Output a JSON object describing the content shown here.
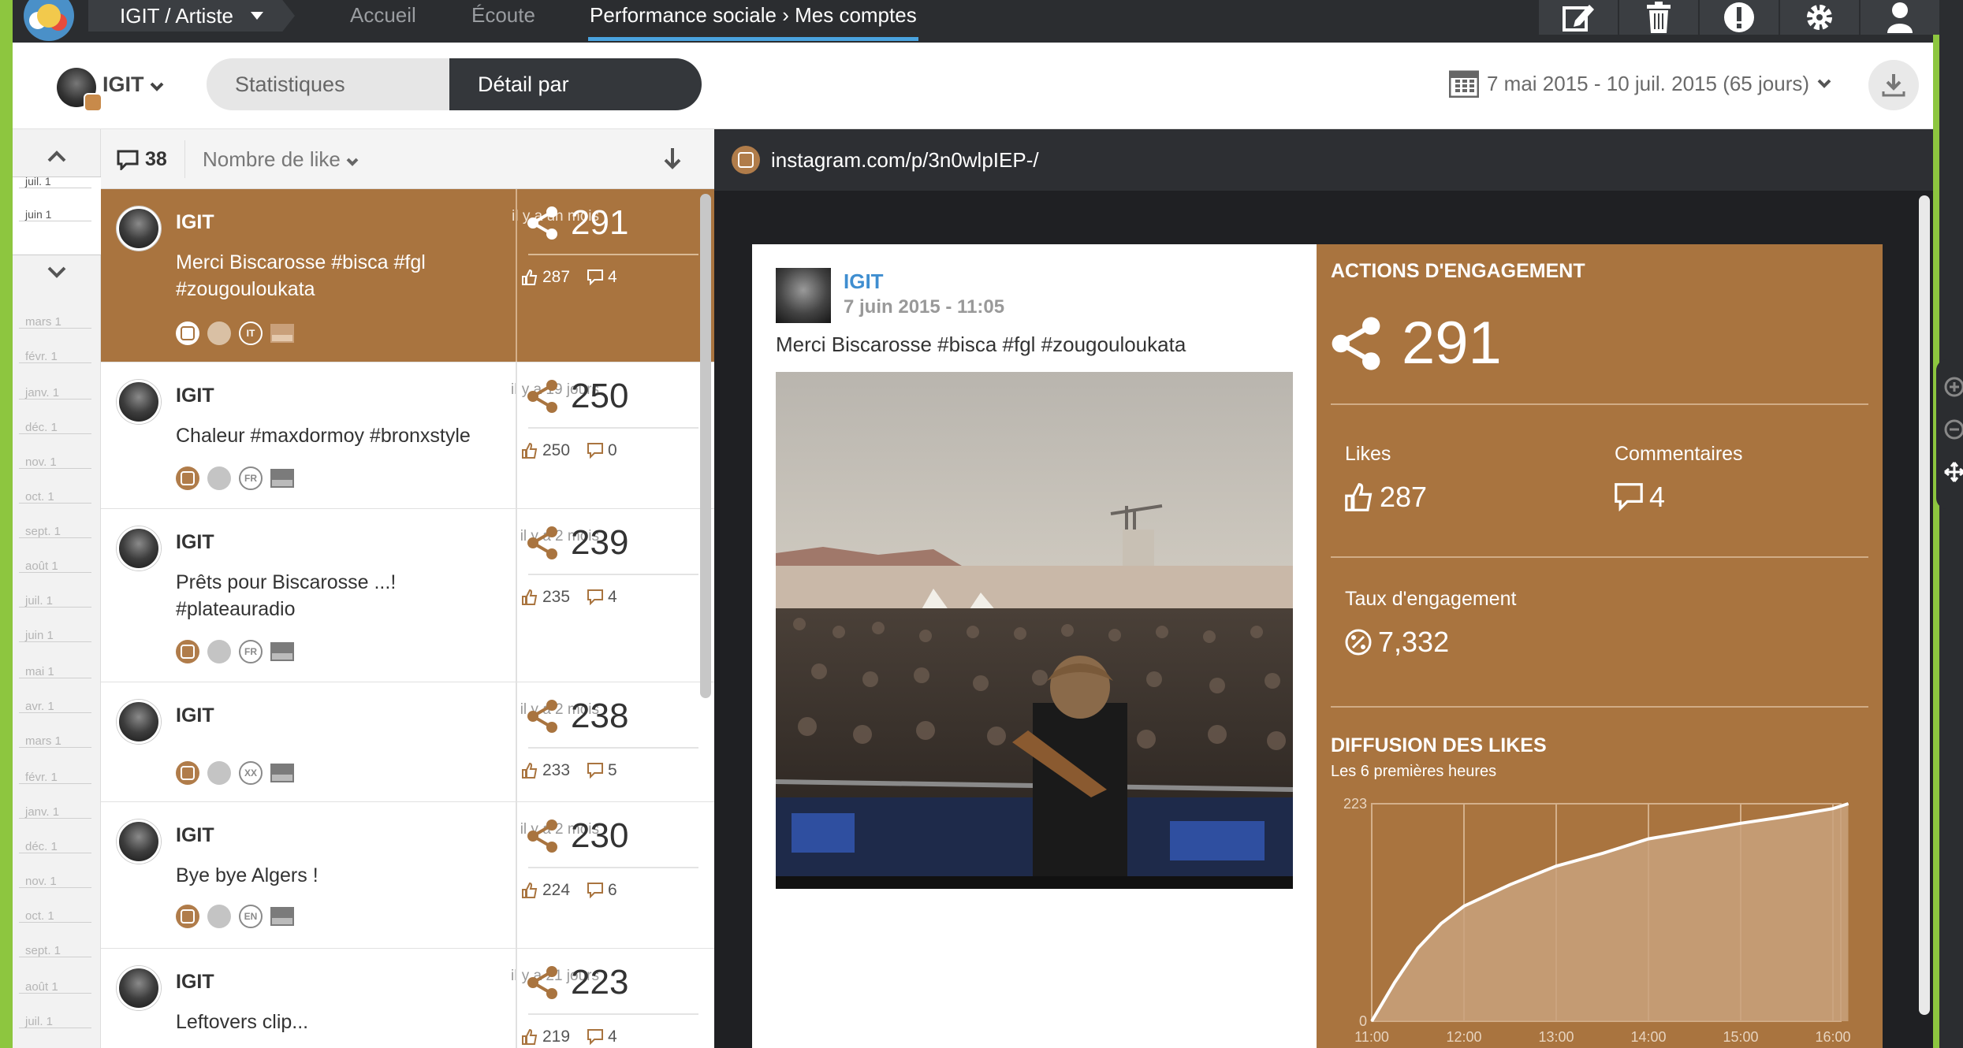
{
  "topnav": {
    "account": "IGIT / Artiste",
    "links": [
      "Accueil",
      "Écoute",
      "Performance sociale › Mes comptes"
    ],
    "icons": [
      "edit-icon",
      "trash-icon",
      "alert-icon",
      "gear-icon",
      "user-icon"
    ]
  },
  "header": {
    "account_name": "IGIT",
    "tabs": [
      "Statistiques globales",
      "Détail par publication"
    ],
    "date_range": "7 mai 2015 - 10 juil. 2015 (65 jours)"
  },
  "timeline": {
    "labels": [
      "juil. 1",
      "juin 1",
      "mai 1",
      "avr. 1",
      "mars 1",
      "févr. 1",
      "janv. 1",
      "déc. 1",
      "nov. 1",
      "oct. 1",
      "sept. 1",
      "août 1",
      "juil. 1",
      "juin 1",
      "mai 1",
      "avr. 1",
      "mars 1",
      "févr. 1",
      "janv. 1",
      "déc. 1",
      "nov. 1",
      "oct. 1",
      "sept. 1",
      "août 1",
      "juil. 1"
    ]
  },
  "list": {
    "count": "38",
    "sort_label": "Nombre de like",
    "posts": [
      {
        "author": "IGIT",
        "time": "il y a un mois",
        "text": "Merci Biscarosse #bisca #fgl #zougouloukata",
        "lang": "IT",
        "shares": "291",
        "likes": "287",
        "comments": "4"
      },
      {
        "author": "IGIT",
        "time": "il y a 19 jours",
        "text": "Chaleur #maxdormoy #bronxstyle",
        "lang": "FR",
        "shares": "250",
        "likes": "250",
        "comments": "0"
      },
      {
        "author": "IGIT",
        "time": "il y a 2 mois",
        "text": "Prêts pour Biscarosse ...! #plateauradio",
        "lang": "FR",
        "shares": "239",
        "likes": "235",
        "comments": "4"
      },
      {
        "author": "IGIT",
        "time": "il y a 2 mois",
        "text": "",
        "lang": "XX",
        "shares": "238",
        "likes": "233",
        "comments": "5"
      },
      {
        "author": "IGIT",
        "time": "il y a 2 mois",
        "text": "Bye bye Algers !",
        "lang": "EN",
        "shares": "230",
        "likes": "224",
        "comments": "6"
      },
      {
        "author": "IGIT",
        "time": "il y a 21 jours",
        "text": "Leftovers clip...",
        "lang": "",
        "shares": "223",
        "likes": "219",
        "comments": "4"
      }
    ]
  },
  "detail": {
    "url": "instagram.com/p/3n0wlpIEP-/",
    "author": "IGIT",
    "date": "7 juin 2015 - 11:05",
    "text": "Merci Biscarosse #bisca #fgl #zougouloukata",
    "engagement_heading": "ACTIONS D'ENGAGEMENT",
    "total": "291",
    "likes_label": "Likes",
    "likes": "287",
    "comments_label": "Commentaires",
    "comments": "4",
    "rate_label": "Taux d'engagement",
    "rate": "7,332",
    "diffusion_heading": "DIFFUSION DES LIKES",
    "diffusion_sub": "Les 6 premières heures"
  },
  "chart_data": {
    "type": "area",
    "title": "DIFFUSION DES LIKES",
    "subtitle": "Les 6 premières heures",
    "x": [
      "11:00",
      "11:15",
      "11:30",
      "11:45",
      "12:00",
      "12:30",
      "13:00",
      "13:30",
      "14:00",
      "14:30",
      "15:00",
      "15:30",
      "16:00",
      "16:10"
    ],
    "values": [
      0,
      40,
      75,
      100,
      118,
      140,
      159,
      172,
      187,
      195,
      203,
      210,
      218,
      223
    ],
    "xticks": [
      "11:00",
      "12:00",
      "13:00",
      "14:00",
      "15:00",
      "16:00"
    ],
    "yticks": [
      "0",
      "223"
    ],
    "ylim": [
      0,
      223
    ],
    "grid": true
  },
  "colors": {
    "accent": "#a9743f",
    "dark": "#2b2d30",
    "link_active": "#4aa3df",
    "author_link": "#3f8ed0",
    "frame_green": "#8dc63f"
  }
}
